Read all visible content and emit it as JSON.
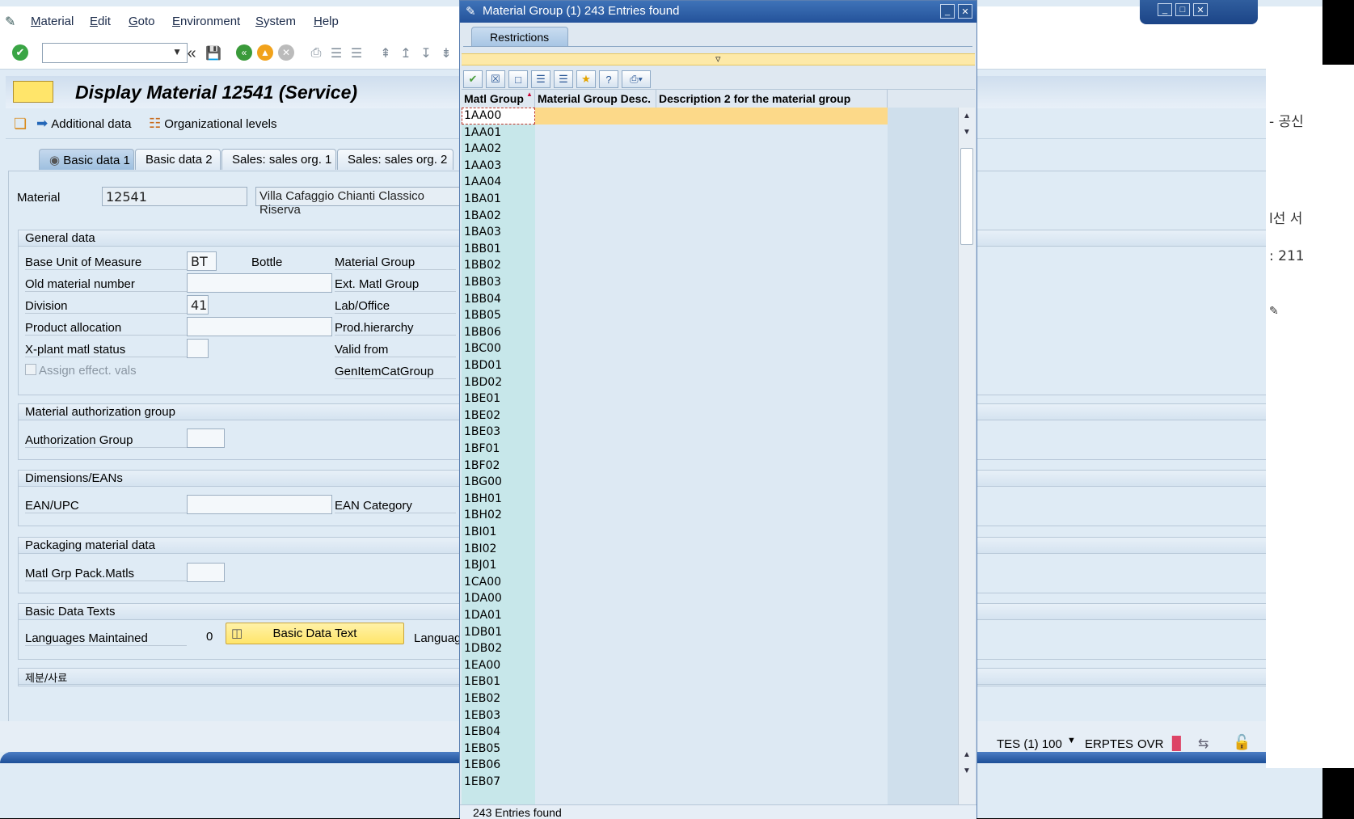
{
  "menu": [
    "Material",
    "Edit",
    "Goto",
    "Environment",
    "System",
    "Help"
  ],
  "page_title": "Display Material 12541 (Service)",
  "app_toolbar": {
    "additional_data": "Additional data",
    "org_levels": "Organizational levels"
  },
  "tabs": [
    "Basic data 1",
    "Basic data 2",
    "Sales: sales org. 1",
    "Sales: sales org. 2"
  ],
  "material": {
    "label": "Material",
    "number": "12541",
    "description": "Villa Cafaggio Chianti Classico Riserva"
  },
  "general_data": {
    "header": "General data",
    "base_uom_label": "Base Unit of Measure",
    "base_uom_value": "BT",
    "base_uom_text": "Bottle",
    "old_material_label": "Old material number",
    "division_label": "Division",
    "division_value": "41",
    "product_allocation_label": "Product allocation",
    "xplant_label": "X-plant matl status",
    "assign_effect_label": "Assign effect. vals",
    "material_group_label": "Material Group",
    "ext_matl_group_label": "Ext. Matl Group",
    "lab_office_label": "Lab/Office",
    "prod_hierarchy_label": "Prod.hierarchy",
    "valid_from_label": "Valid from",
    "genitemcat_label": "GenItemCatGroup"
  },
  "auth_group": {
    "header": "Material authorization group",
    "label": "Authorization Group"
  },
  "dimensions": {
    "header": "Dimensions/EANs",
    "ean_label": "EAN/UPC",
    "ean_cat_label": "EAN Category"
  },
  "packaging": {
    "header": "Packaging material data",
    "label": "Matl Grp Pack.Matls"
  },
  "basic_texts": {
    "header": "Basic Data Texts",
    "languages_label": "Languages Maintained",
    "languages_value": "0",
    "button": "Basic Data Text",
    "language_label": "Language"
  },
  "korean_section": {
    "header": "제분/사료"
  },
  "status_bar": {
    "system": "TES (1) 100",
    "server": "ERPTES",
    "mode": "OVR"
  },
  "right_window": {
    "line1": "- 공신",
    "line2": "l선 서",
    "line3": ": 211"
  },
  "popup": {
    "title": "Material Group (1)  243 Entries found",
    "restrictions_tab": "Restrictions",
    "columns": [
      "Matl Group",
      "Material Group Desc.",
      "Description 2 for the material group"
    ],
    "rows": [
      "1AA00",
      "1AA01",
      "1AA02",
      "1AA03",
      "1AA04",
      "1BA01",
      "1BA02",
      "1BA03",
      "1BB01",
      "1BB02",
      "1BB03",
      "1BB04",
      "1BB05",
      "1BB06",
      "1BC00",
      "1BD01",
      "1BD02",
      "1BE01",
      "1BE02",
      "1BE03",
      "1BF01",
      "1BF02",
      "1BG00",
      "1BH01",
      "1BH02",
      "1BI01",
      "1BI02",
      "1BJ01",
      "1CA00",
      "1DA00",
      "1DA01",
      "1DB01",
      "1DB02",
      "1EA00",
      "1EB01",
      "1EB02",
      "1EB03",
      "1EB04",
      "1EB05",
      "1EB06",
      "1EB07"
    ],
    "selected_row": "1AA00",
    "status": "243 Entries found"
  }
}
